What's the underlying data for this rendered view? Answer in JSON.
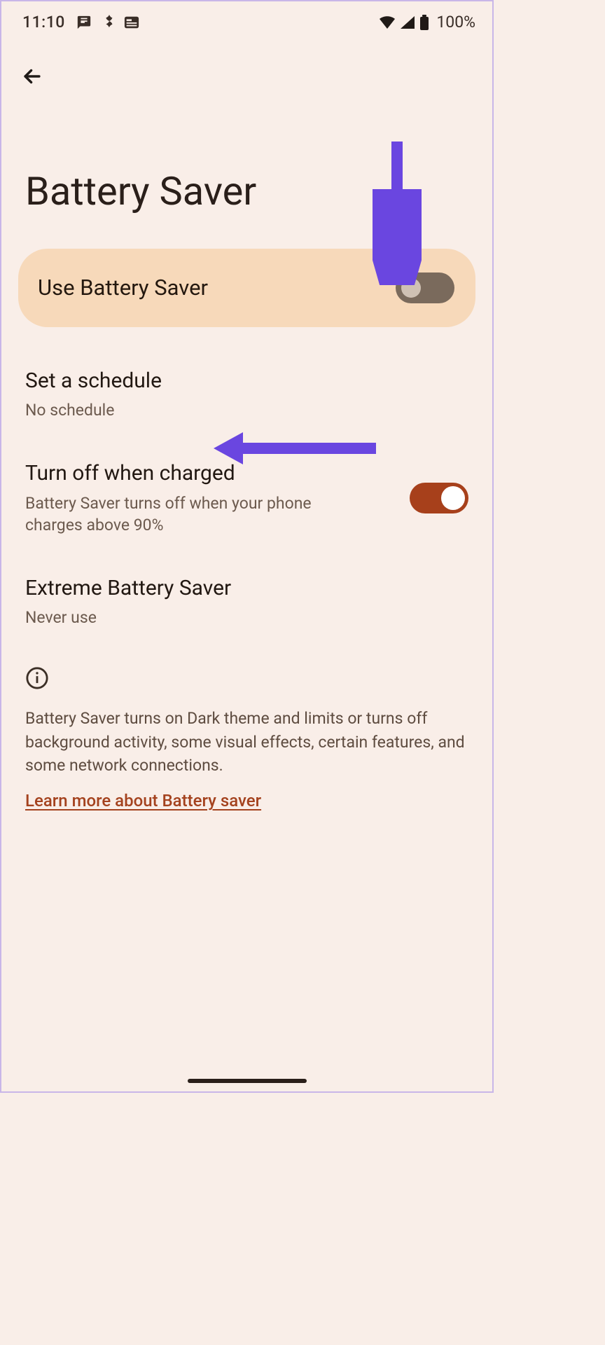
{
  "status": {
    "time": "11:10",
    "battery_pct": "100%"
  },
  "page": {
    "title": "Battery Saver"
  },
  "primary": {
    "label": "Use Battery Saver",
    "enabled": false
  },
  "items": {
    "schedule": {
      "title": "Set a schedule",
      "subtitle": "No schedule"
    },
    "turn_off": {
      "title": "Turn off when charged",
      "subtitle": "Battery Saver turns off when your phone charges above 90%",
      "enabled": true
    },
    "extreme": {
      "title": "Extreme Battery Saver",
      "subtitle": "Never use"
    }
  },
  "info": {
    "text": "Battery Saver turns on Dark theme and limits or turns off background activity, some visual effects, certain features, and some network connections.",
    "learn_more": "Learn more about Battery saver"
  },
  "colors": {
    "accent_arrow": "#6a46e0",
    "toggle_on": "#a7401b",
    "link": "#a4421e",
    "card_bg": "#f7d9ba",
    "page_bg": "#f9eee8"
  }
}
